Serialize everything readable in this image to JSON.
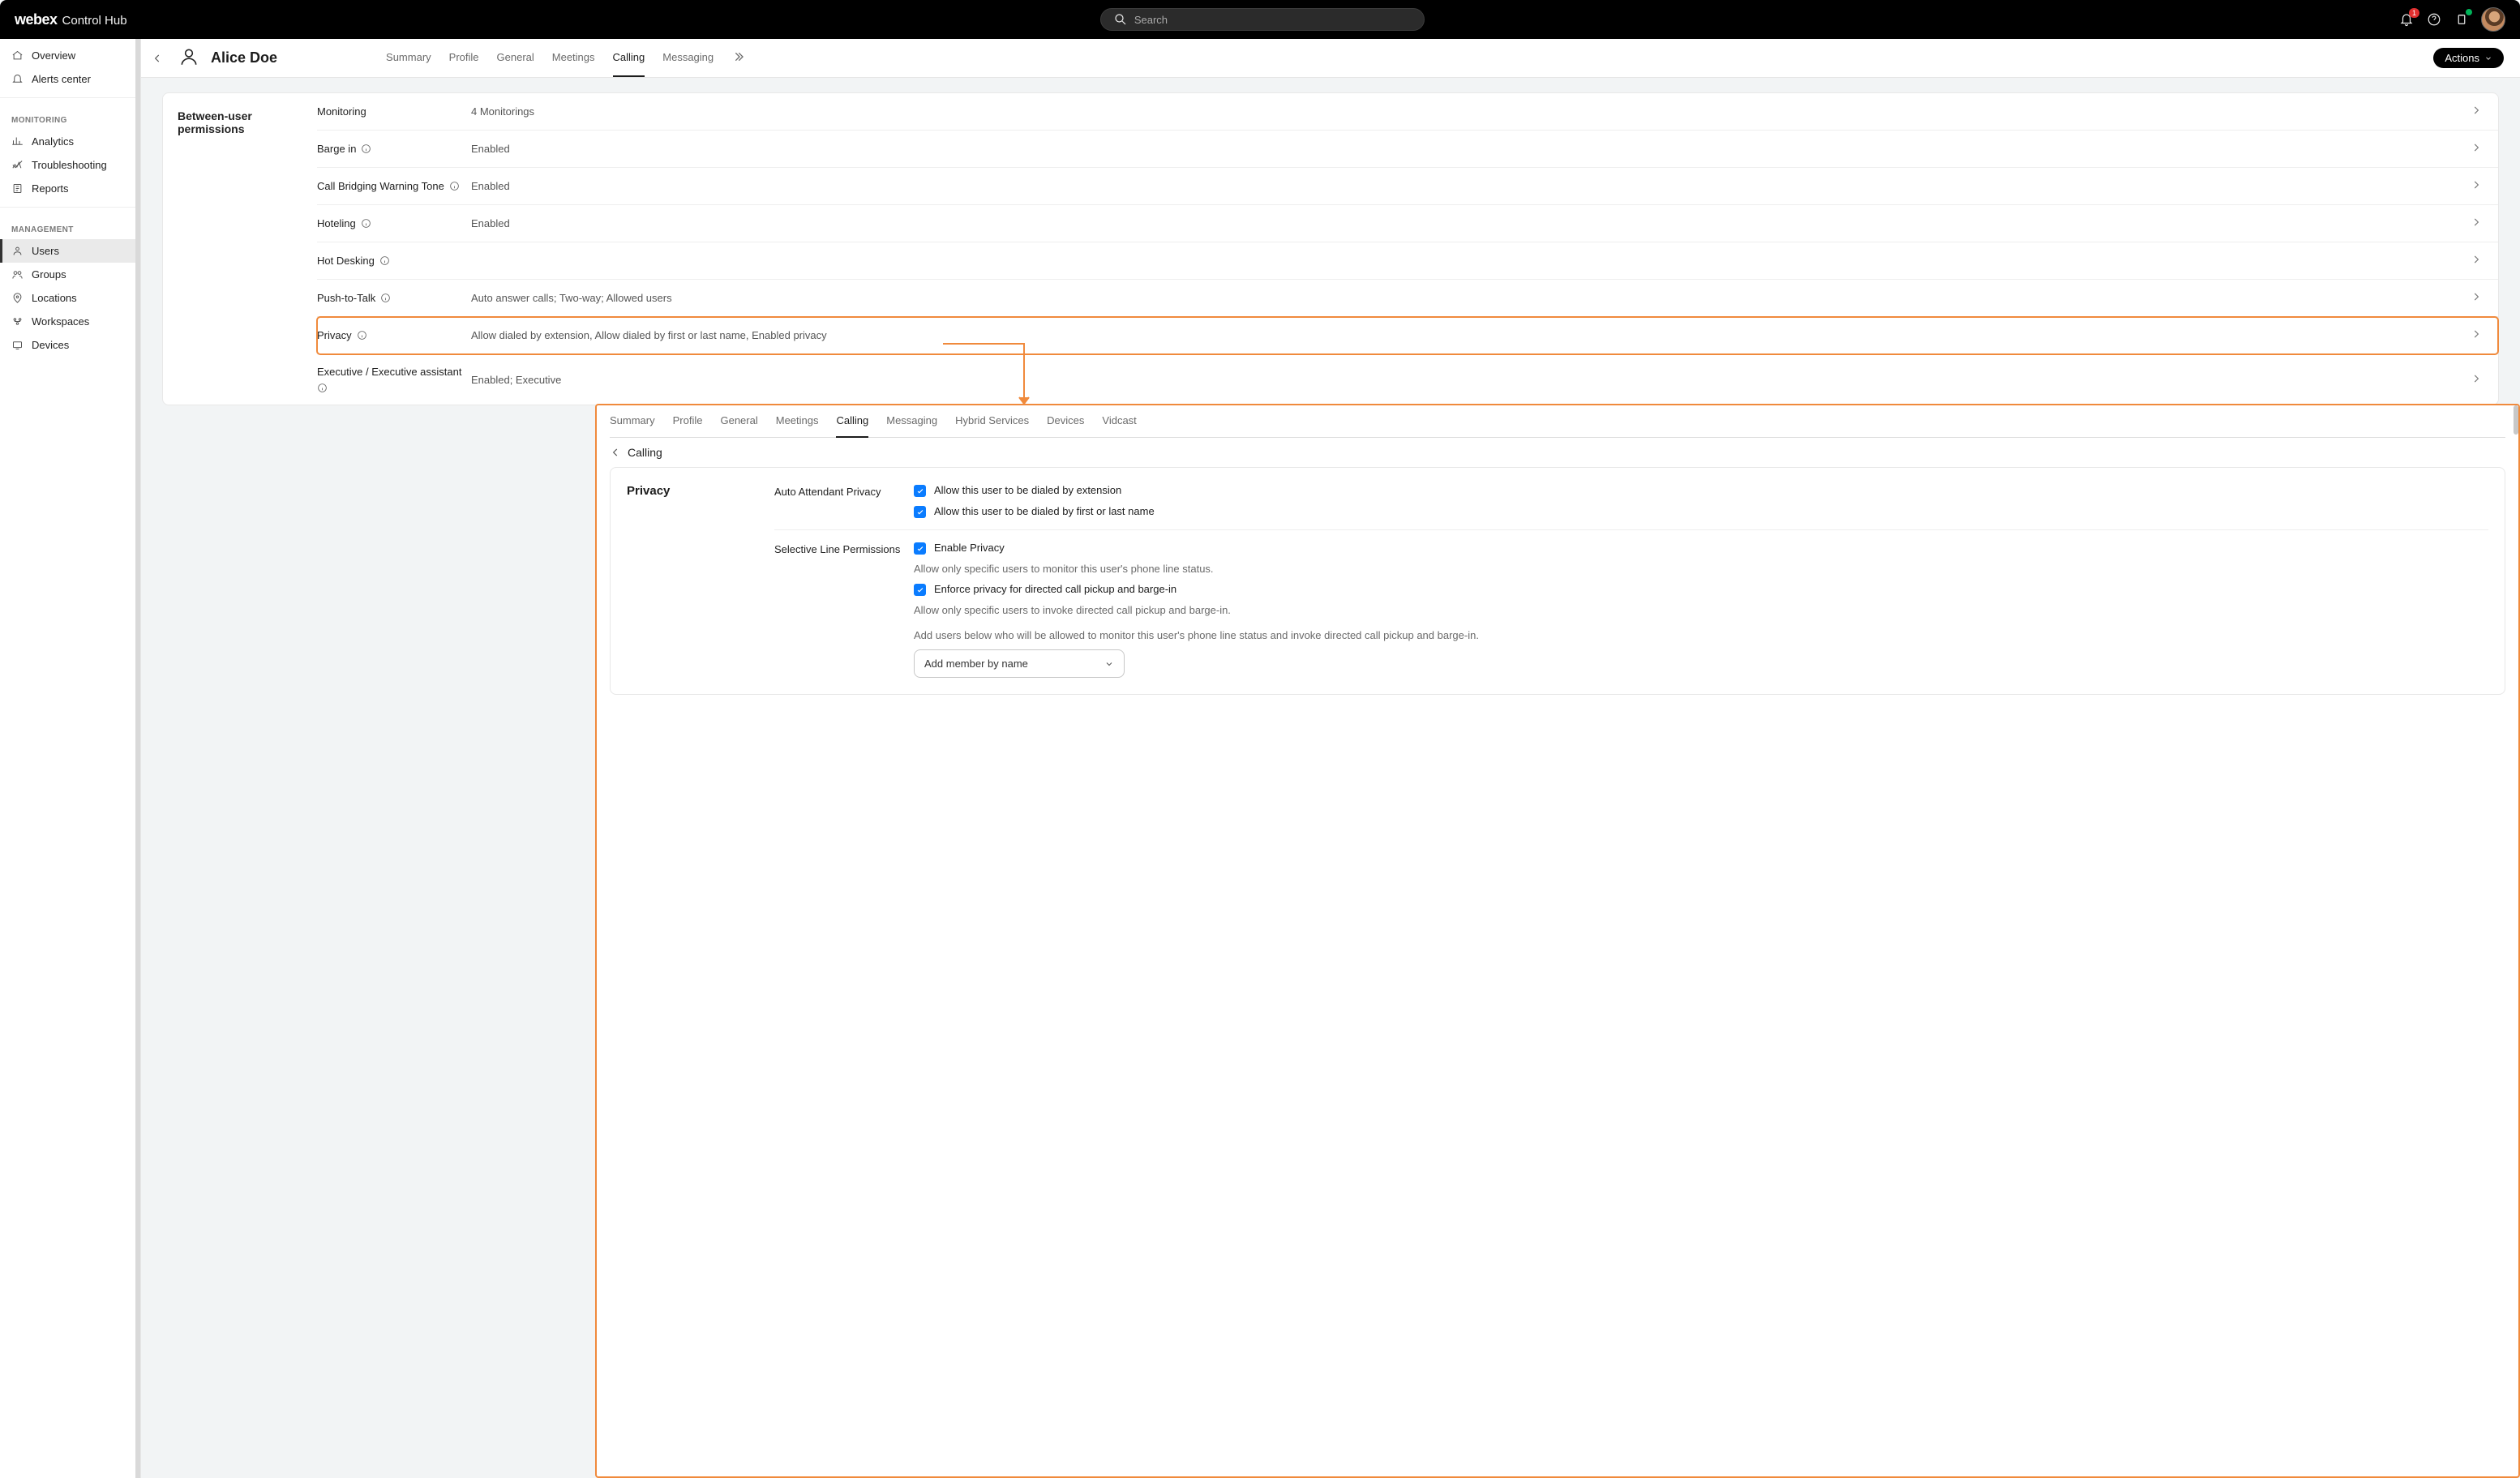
{
  "brand": {
    "word1": "webex",
    "word2": "Control Hub"
  },
  "search": {
    "placeholder": "Search"
  },
  "topbar": {
    "notif_count": "1"
  },
  "sidebar": {
    "items": [
      {
        "label": "Overview"
      },
      {
        "label": "Alerts center"
      }
    ],
    "monitoring_header": "MONITORING",
    "monitoring": [
      {
        "label": "Analytics"
      },
      {
        "label": "Troubleshooting"
      },
      {
        "label": "Reports"
      }
    ],
    "management_header": "MANAGEMENT",
    "management": [
      {
        "label": "Users"
      },
      {
        "label": "Groups"
      },
      {
        "label": "Locations"
      },
      {
        "label": "Workspaces"
      },
      {
        "label": "Devices"
      }
    ]
  },
  "user": {
    "name": "Alice Doe",
    "tabs": [
      {
        "label": "Summary"
      },
      {
        "label": "Profile"
      },
      {
        "label": "General"
      },
      {
        "label": "Meetings"
      },
      {
        "label": "Calling"
      },
      {
        "label": "Messaging"
      }
    ],
    "actions_label": "Actions"
  },
  "card": {
    "title": "Between-user permissions",
    "rows": [
      {
        "label": "Monitoring",
        "value": "4 Monitorings",
        "info": false
      },
      {
        "label": "Barge in",
        "value": "Enabled",
        "info": true
      },
      {
        "label": "Call Bridging Warning Tone",
        "value": "Enabled",
        "info": true
      },
      {
        "label": "Hoteling",
        "value": "Enabled",
        "info": true
      },
      {
        "label": "Hot Desking",
        "value": "",
        "info": true
      },
      {
        "label": "Push-to-Talk",
        "value": "Auto answer calls; Two-way; Allowed users",
        "info": true
      },
      {
        "label": "Privacy",
        "value": "Allow dialed by extension, Allow dialed by first or last name, Enabled privacy",
        "info": true
      },
      {
        "label": "Executive / Executive assistant",
        "value": "Enabled; Executive",
        "info": true
      }
    ]
  },
  "detail": {
    "tabs": [
      {
        "label": "Summary"
      },
      {
        "label": "Profile"
      },
      {
        "label": "General"
      },
      {
        "label": "Meetings"
      },
      {
        "label": "Calling"
      },
      {
        "label": "Messaging"
      },
      {
        "label": "Hybrid Services"
      },
      {
        "label": "Devices"
      },
      {
        "label": "Vidcast"
      }
    ],
    "breadcrumb": "Calling",
    "section_title": "Privacy",
    "group1": {
      "title": "Auto Attendant Privacy",
      "opt1": "Allow this user to be dialed by extension",
      "opt2": "Allow this user to be dialed by first or last name"
    },
    "group2": {
      "title": "Selective Line Permissions",
      "opt1": "Enable Privacy",
      "help1": "Allow only specific users to monitor this user's phone line status.",
      "opt2": "Enforce privacy for directed call pickup and barge-in",
      "help2": "Allow only specific users to invoke directed call pickup and barge-in.",
      "help3": "Add users below who will be allowed to monitor this user's phone line status and invoke directed call pickup and barge-in.",
      "add_label": "Add member by name"
    }
  }
}
